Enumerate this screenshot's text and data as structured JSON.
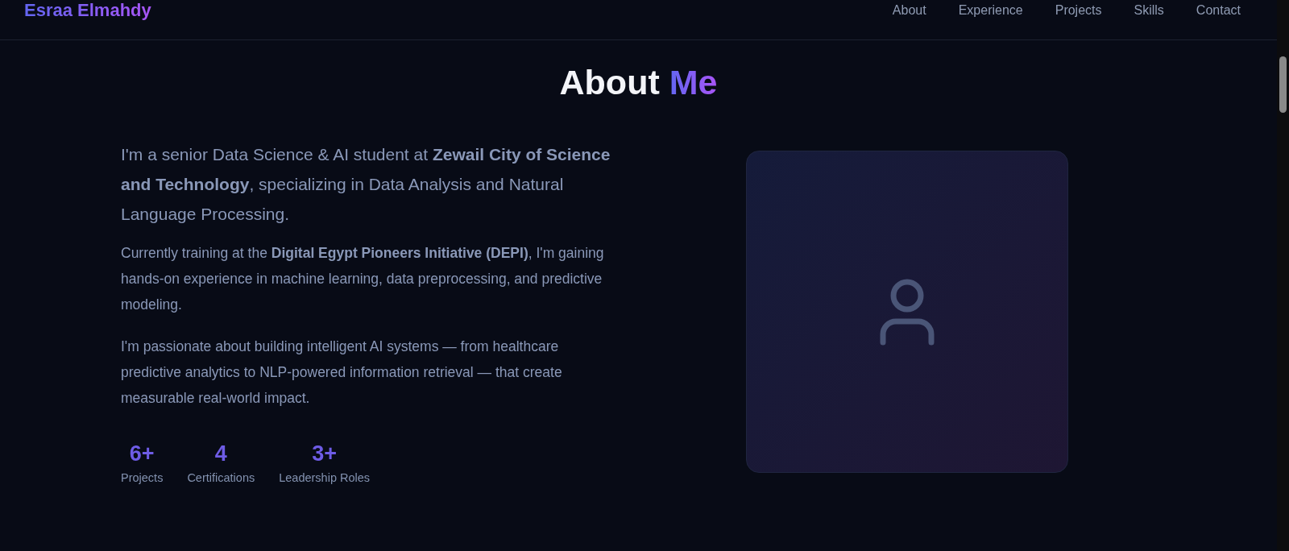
{
  "nav": {
    "logo": "Esraa Elmahdy",
    "links": [
      {
        "label": "About"
      },
      {
        "label": "Experience"
      },
      {
        "label": "Projects"
      },
      {
        "label": "Skills"
      },
      {
        "label": "Contact"
      }
    ]
  },
  "about": {
    "title": "About",
    "title_accent": "Me",
    "lead": "I'm a senior Data Science & AI student at **Zewail City of Science and Technology**, specializing in Data Analysis and Natural Language Processing.",
    "paragraphs": [
      "Currently training at the **Digital Egypt Pioneers Initiative (DEPI)**, I'm gaining hands-on experience in machine learning, data preprocessing, and predictive modeling.",
      "I'm passionate about building intelligent AI systems — from healthcare predictive analytics to NLP-powered information retrieval — that create measurable real-world impact."
    ],
    "stats": [
      {
        "value": "6+",
        "label": "Projects"
      },
      {
        "value": "4",
        "label": "Certifications"
      },
      {
        "value": "3+",
        "label": "Leadership Roles"
      }
    ]
  }
}
